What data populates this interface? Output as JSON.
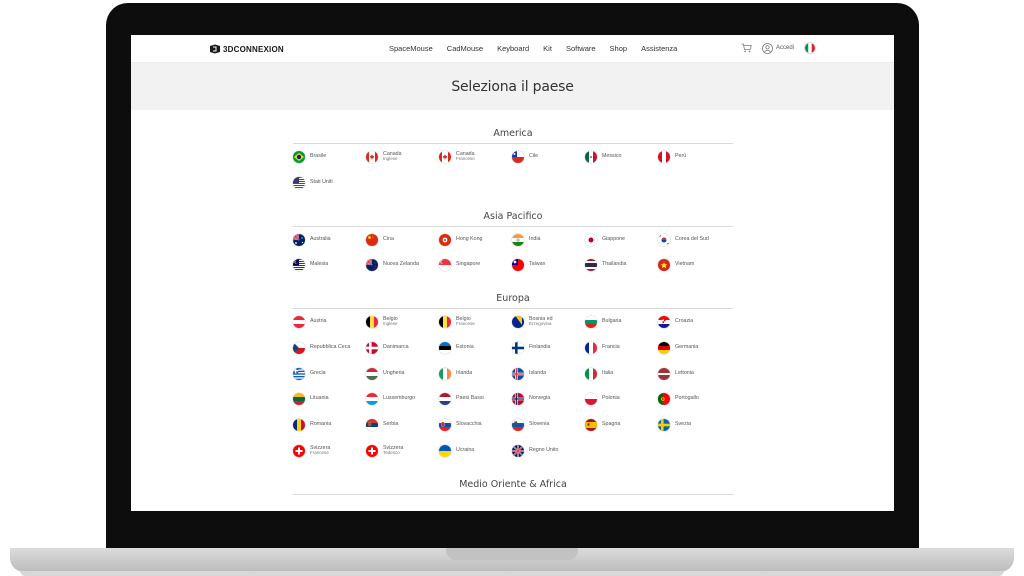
{
  "logo": {
    "text": "3DCONNEXION"
  },
  "nav": [
    "SpaceMouse",
    "CadMouse",
    "Keyboard",
    "Kit",
    "Software",
    "Shop",
    "Assistenza"
  ],
  "util": {
    "login_label": "Accedi"
  },
  "page": {
    "title": "Seleziona il paese"
  },
  "regions": [
    {
      "name": "America",
      "countries": [
        {
          "name": "Brasile",
          "flag": "br"
        },
        {
          "name": "Canada",
          "sub": "Inglese",
          "flag": "ca"
        },
        {
          "name": "Canada",
          "sub": "Francese",
          "flag": "ca"
        },
        {
          "name": "Cile",
          "flag": "cl"
        },
        {
          "name": "Messico",
          "flag": "mx"
        },
        {
          "name": "Perù",
          "flag": "pe"
        },
        {
          "name": "Stati Uniti",
          "flag": "us"
        }
      ]
    },
    {
      "name": "Asia Pacifico",
      "countries": [
        {
          "name": "Australia",
          "flag": "au"
        },
        {
          "name": "Cina",
          "flag": "cn"
        },
        {
          "name": "Hong Kong",
          "flag": "hk"
        },
        {
          "name": "India",
          "flag": "in"
        },
        {
          "name": "Giappone",
          "flag": "jp"
        },
        {
          "name": "Corea del Sud",
          "flag": "kr"
        },
        {
          "name": "Malesia",
          "flag": "my"
        },
        {
          "name": "Nuova Zelanda",
          "flag": "nz"
        },
        {
          "name": "Singapore",
          "flag": "sg"
        },
        {
          "name": "Taiwan",
          "flag": "tw"
        },
        {
          "name": "Thailandia",
          "flag": "th"
        },
        {
          "name": "Vietnam",
          "flag": "vn"
        }
      ]
    },
    {
      "name": "Europa",
      "countries": [
        {
          "name": "Austria",
          "flag": "at"
        },
        {
          "name": "Belgio",
          "sub": "Inglese",
          "flag": "be"
        },
        {
          "name": "Belgio",
          "sub": "Francese",
          "flag": "be"
        },
        {
          "name": "Bosnia ed",
          "sub": "Erzegovina",
          "flag": "ba"
        },
        {
          "name": "Bulgaria",
          "flag": "bg"
        },
        {
          "name": "Croazia",
          "flag": "hr"
        },
        {
          "name": "Repubblica Ceca",
          "flag": "cz"
        },
        {
          "name": "Danimarca",
          "flag": "dk"
        },
        {
          "name": "Estonia",
          "flag": "ee"
        },
        {
          "name": "Finlandia",
          "flag": "fi"
        },
        {
          "name": "Francia",
          "flag": "fr"
        },
        {
          "name": "Germania",
          "flag": "de"
        },
        {
          "name": "Grecia",
          "flag": "gr"
        },
        {
          "name": "Ungheria",
          "flag": "hu"
        },
        {
          "name": "Irlanda",
          "flag": "ie"
        },
        {
          "name": "Islanda",
          "flag": "is"
        },
        {
          "name": "Italia",
          "flag": "it"
        },
        {
          "name": "Lettonia",
          "flag": "lv"
        },
        {
          "name": "Lituania",
          "flag": "lt"
        },
        {
          "name": "Lussemburgo",
          "flag": "lu"
        },
        {
          "name": "Paesi Bassi",
          "flag": "nl"
        },
        {
          "name": "Norvegia",
          "flag": "no"
        },
        {
          "name": "Polonia",
          "flag": "pl"
        },
        {
          "name": "Portogallo",
          "flag": "pt"
        },
        {
          "name": "Romania",
          "flag": "ro"
        },
        {
          "name": "Serbia",
          "flag": "rs"
        },
        {
          "name": "Slovacchia",
          "flag": "sk"
        },
        {
          "name": "Slovenia",
          "flag": "si"
        },
        {
          "name": "Spagna",
          "flag": "es"
        },
        {
          "name": "Svezia",
          "flag": "se"
        },
        {
          "name": "Svizzera",
          "sub": "Francese",
          "flag": "ch"
        },
        {
          "name": "Svizzera",
          "sub": "Tedesco",
          "flag": "ch"
        },
        {
          "name": "Ucraina",
          "flag": "ua"
        },
        {
          "name": "Regno Unito",
          "flag": "gb"
        }
      ]
    },
    {
      "name": "Medio Oriente & Africa",
      "countries": []
    }
  ]
}
